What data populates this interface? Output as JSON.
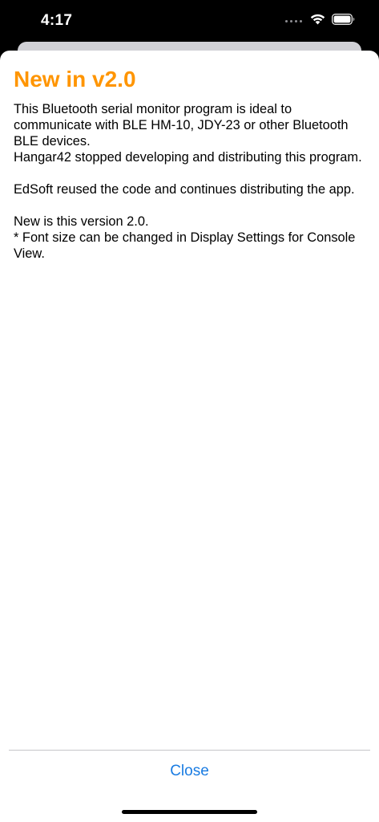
{
  "status_bar": {
    "time": "4:17"
  },
  "sheet": {
    "title": "New in v2.0",
    "title_color": "#ff9500",
    "paragraphs": [
      "This Bluetooth serial monitor program is ideal to communicate with BLE HM-10, JDY-23 or other Bluetooth BLE devices.",
      "Hangar42 stopped developing and distributing this program.",
      "",
      "EdSoft reused the code and continues distributing the app.",
      "",
      "New is this version 2.0.",
      "* Font size can be changed in Display Settings for Console View."
    ],
    "close_label": "Close",
    "close_color": "#1a7ce2"
  },
  "icons": {
    "signal": "signal-dots-icon",
    "wifi": "wifi-icon",
    "battery": "battery-icon"
  }
}
